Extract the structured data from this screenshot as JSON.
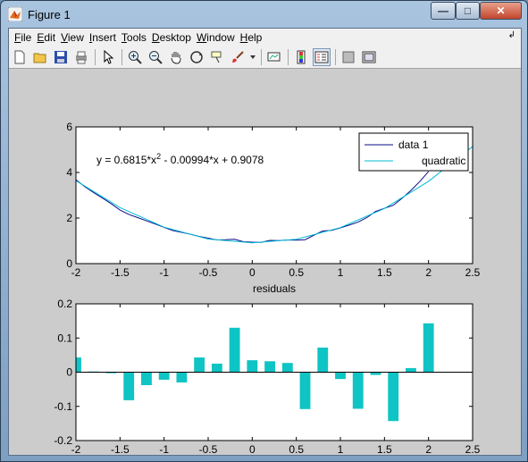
{
  "window": {
    "title": "Figure 1",
    "buttons": {
      "minimize": "—",
      "maximize": "□",
      "close": "✕"
    }
  },
  "menubar": {
    "items": [
      "File",
      "Edit",
      "View",
      "Insert",
      "Tools",
      "Desktop",
      "Window",
      "Help"
    ],
    "underline": [
      "F",
      "E",
      "V",
      "I",
      "T",
      "D",
      "W",
      "H"
    ],
    "overflow_arrow": "↲"
  },
  "toolbar": {
    "icons": [
      "new-figure-icon",
      "open-file-icon",
      "save-icon",
      "print-icon",
      "edit-plot-arrow-icon",
      "zoom-in-icon",
      "zoom-out-icon",
      "pan-hand-icon",
      "rotate-3d-icon",
      "data-cursor-icon",
      "brush-icon",
      "link-plot-icon",
      "colorbar-icon",
      "legend-icon",
      "hide-plot-tools-icon",
      "show-plot-tools-icon"
    ]
  },
  "chart_data": [
    {
      "type": "line",
      "xlim": [
        -2,
        2.5
      ],
      "ylim": [
        0,
        6
      ],
      "xticks": [
        "-2",
        "-1.5",
        "-1",
        "-0.5",
        "0",
        "0.5",
        "1",
        "1.5",
        "2",
        "2.5"
      ],
      "yticks": [
        "0",
        "2",
        "4",
        "6"
      ],
      "xlabel": "residuals",
      "annotation": "y = 0.6815*x^2 - 0.00994*x + 0.9078",
      "legend": {
        "placement": "top-right",
        "entries": [
          "data 1",
          "quadratic"
        ]
      },
      "series": [
        {
          "name": "data 1",
          "color": "#0b0b8a",
          "x": [
            -2.0,
            -1.9,
            -1.8,
            -1.7,
            -1.6,
            -1.5,
            -1.4,
            -1.3,
            -1.2,
            -1.1,
            -1.0,
            -0.9,
            -0.8,
            -0.7,
            -0.6,
            -0.5,
            -0.4,
            -0.3,
            -0.2,
            -0.1,
            0.0,
            0.1,
            0.2,
            0.3,
            0.4,
            0.5,
            0.6,
            0.7,
            0.8,
            0.9,
            1.0,
            1.1,
            1.2,
            1.3,
            1.4,
            1.5,
            1.6,
            1.7,
            1.8,
            1.9,
            2.0
          ],
          "y": [
            3.68,
            3.38,
            3.12,
            2.88,
            2.63,
            2.35,
            2.16,
            2.02,
            1.88,
            1.74,
            1.59,
            1.45,
            1.37,
            1.29,
            1.19,
            1.12,
            1.04,
            1.05,
            1.07,
            0.96,
            0.94,
            0.93,
            1.02,
            1.01,
            1.04,
            1.03,
            1.05,
            1.25,
            1.43,
            1.46,
            1.57,
            1.69,
            1.82,
            2.02,
            2.29,
            2.43,
            2.56,
            2.87,
            3.21,
            3.6,
            4.04
          ]
        },
        {
          "name": "quadratic",
          "color": "#00bcd4",
          "x": [
            -2.0,
            -1.5,
            -1.0,
            -0.5,
            0.0,
            0.5,
            1.0,
            1.5,
            2.0,
            2.5
          ],
          "y": [
            3.64,
            2.46,
            1.6,
            1.08,
            0.91,
            1.07,
            1.58,
            2.42,
            3.61,
            5.14
          ]
        }
      ]
    },
    {
      "type": "bar",
      "xlim": [
        -2,
        2.5
      ],
      "ylim": [
        -0.2,
        0.2
      ],
      "xticks": [
        "-2",
        "-1.5",
        "-1",
        "-0.5",
        "0",
        "0.5",
        "1",
        "1.5",
        "2",
        "2.5"
      ],
      "yticks": [
        "-0.2",
        "-0.1",
        "0",
        "0.1",
        "0.2"
      ],
      "color": "#0fc4c4",
      "x": [
        -2.0,
        -1.8,
        -1.6,
        -1.4,
        -1.2,
        -1.0,
        -0.8,
        -0.6,
        -0.4,
        -0.2,
        0.0,
        0.2,
        0.4,
        0.6,
        0.8,
        1.0,
        1.2,
        1.4,
        1.6,
        1.8,
        2.0
      ],
      "values": [
        0.043,
        0.002,
        -0.003,
        -0.082,
        -0.038,
        -0.022,
        -0.03,
        0.043,
        0.025,
        0.13,
        0.035,
        0.032,
        0.027,
        -0.108,
        0.072,
        -0.02,
        -0.107,
        -0.008,
        -0.143,
        0.012,
        0.143
      ]
    }
  ]
}
